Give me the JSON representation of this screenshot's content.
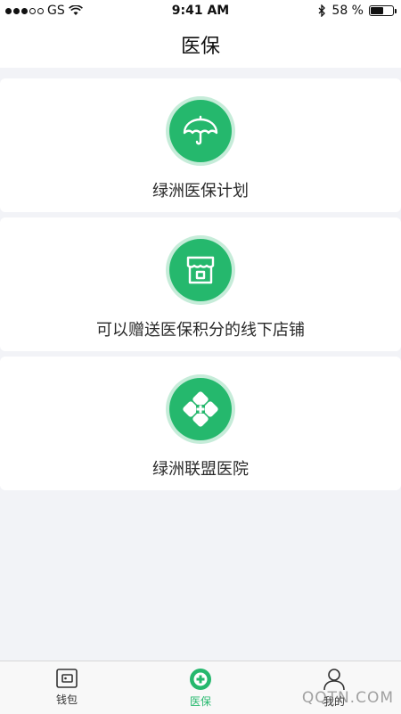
{
  "status_bar": {
    "carrier": "GS",
    "time": "9:41 AM",
    "battery_percent": "58 %",
    "battery_level": 0.58,
    "icons": [
      "signal-dots-icon",
      "wifi-icon",
      "bluetooth-icon",
      "battery-icon"
    ]
  },
  "nav": {
    "title": "医保"
  },
  "cards": [
    {
      "label": "绿洲医保计划",
      "icon": "umbrella-icon"
    },
    {
      "label": "可以赠送医保积分的线下店铺",
      "icon": "store-icon"
    },
    {
      "label": "绿洲联盟医院",
      "icon": "medical-cross-icon"
    }
  ],
  "tabs": [
    {
      "label": "钱包",
      "icon": "wallet-icon",
      "active": false
    },
    {
      "label": "医保",
      "icon": "plus-circle-icon",
      "active": true
    },
    {
      "label": "我的",
      "icon": "person-icon",
      "active": false
    }
  ],
  "watermark": "QQTN.COM",
  "colors": {
    "accent": "#25b86d",
    "accent_light": "#c6ecd9",
    "background": "#f2f3f7"
  }
}
